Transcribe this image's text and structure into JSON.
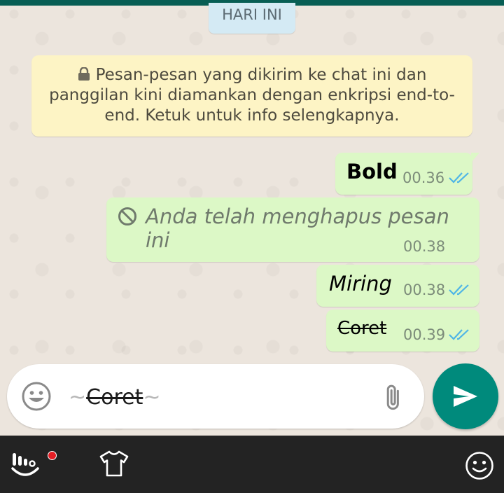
{
  "date_chip": "HARI INI",
  "encryption_notice": "Pesan-pesan yang dikirim ke chat ini dan panggilan kini diamankan dengan enkripsi end-to-end. Ketuk untuk info selengkapnya.",
  "messages": [
    {
      "text": "Bold",
      "time": "00.36",
      "status": "read",
      "style": "bold"
    },
    {
      "text": "Anda telah menghapus pesan ini",
      "time": "00.38",
      "status": "deleted",
      "style": "italic"
    },
    {
      "text": "Miring",
      "time": "00.38",
      "status": "read",
      "style": "italic"
    },
    {
      "text": "Coret",
      "time": "00.39",
      "status": "read",
      "style": "strikethrough"
    }
  ],
  "composer": {
    "prefix": "~",
    "value": "Coret",
    "suffix": "~"
  },
  "colors": {
    "bubble": "#dcf8c6",
    "notice": "#fdf4c5",
    "read_ticks": "#4fb5e6",
    "send_button": "#008a7c",
    "keyboard_bar": "#232323"
  },
  "icons": [
    "lock-icon",
    "blocked-icon",
    "double-check-icon",
    "emoji-icon",
    "attach-icon",
    "send-icon",
    "keyboard-logo-icon",
    "theme-shirt-icon",
    "emoji-panel-icon"
  ]
}
